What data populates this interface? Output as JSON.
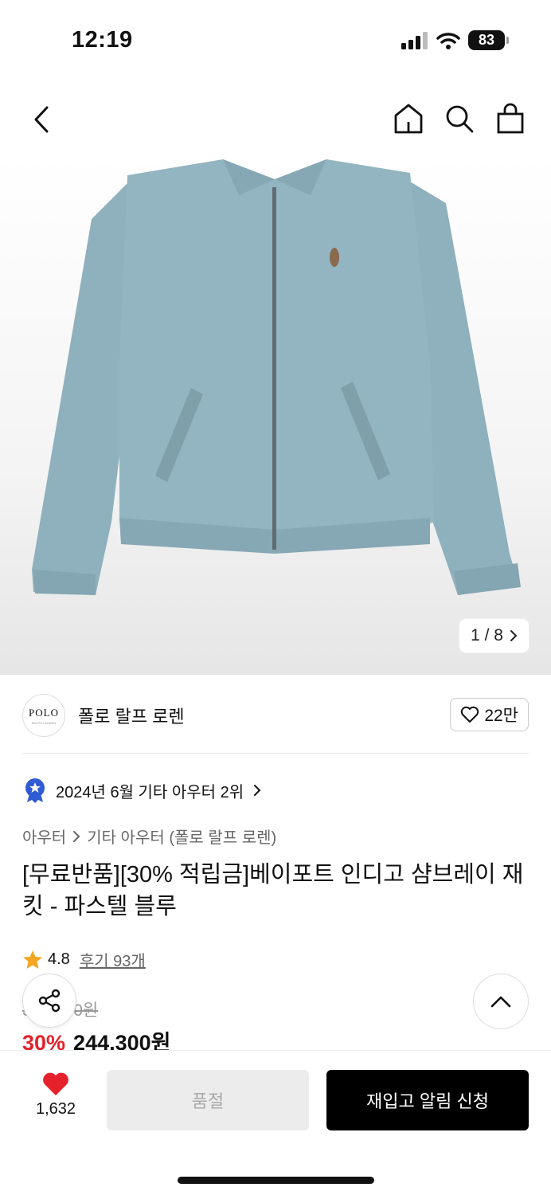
{
  "status_bar": {
    "time": "12:19",
    "battery": "83"
  },
  "gallery": {
    "counter": "1 / 8",
    "image_alt": "jacket-photo"
  },
  "brand": {
    "logo_text": "POLO",
    "logo_sub": "RALPH LAUREN",
    "name": "폴로 랄프 로렌",
    "likes": "22만"
  },
  "ranking": {
    "text": "2024년 6월 기타 아우터 2위"
  },
  "breadcrumb": {
    "level1": "아우터",
    "level2": "기타 아우터 (폴로 랄프 로렌)"
  },
  "product": {
    "title": "[무료반품][30% 적립금]베이포트 인디고 샴브레이 재킷 - 파스텔 블루",
    "rating": "4.8",
    "reviews": "후기 93개",
    "original_price": "349,000원",
    "discount": "30%",
    "sale_price": "244,300원"
  },
  "bottom_bar": {
    "wish_count": "1,632",
    "soldout_label": "품절",
    "restock_label": "재입고 알림 신청"
  },
  "colors": {
    "accent_red": "#e5222b",
    "star": "#f5a623",
    "badge_blue": "#2f5bd3",
    "jacket": "#8fb0bd"
  }
}
